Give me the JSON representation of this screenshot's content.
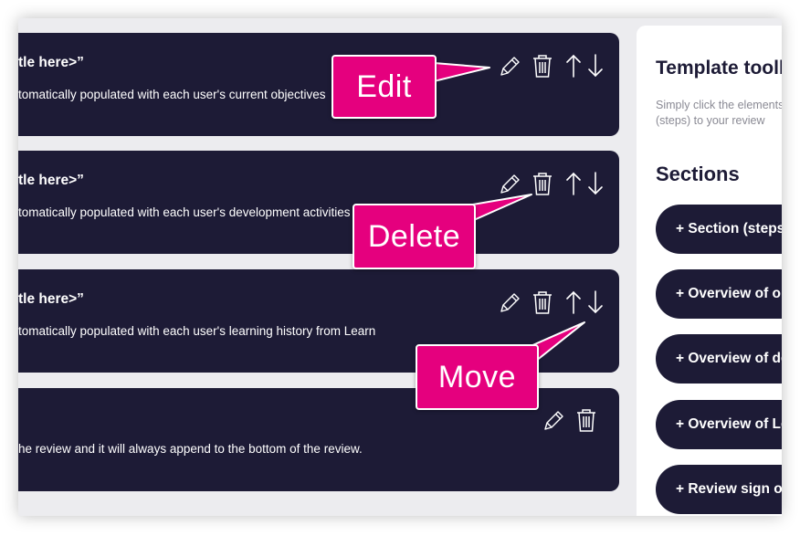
{
  "cards": [
    {
      "title": "tle here>”",
      "description": "tomatically populated with each user's current objectives"
    },
    {
      "title": "tle here>”",
      "description": "tomatically populated with each user's development activities"
    },
    {
      "title": "tle here>”",
      "description": "tomatically populated with each user's learning history from Learn"
    },
    {
      "title": "",
      "description": "he review and it will always append to the bottom of the review."
    }
  ],
  "panel": {
    "title": "Template toolbox",
    "description_lines": [
      "Simply click the elements",
      "(steps) to your review"
    ],
    "sections_heading": "Sections",
    "buttons": [
      "+ Section (steps)",
      "+ Overview of objectives",
      "+ Overview of development",
      "+ Overview of Learn",
      "+ Review sign off"
    ]
  },
  "callouts": {
    "edit": "Edit",
    "delete": "Delete",
    "move": "Move"
  },
  "icons": {
    "edit": "pencil-icon",
    "delete": "trash-icon",
    "move_up": "arrow-up-icon",
    "move_down": "arrow-down-icon"
  },
  "colors": {
    "card_bg": "#1d1b36",
    "callout": "#e5007e",
    "panel_bg": "#ffffff",
    "page_bg": "#ececef"
  }
}
